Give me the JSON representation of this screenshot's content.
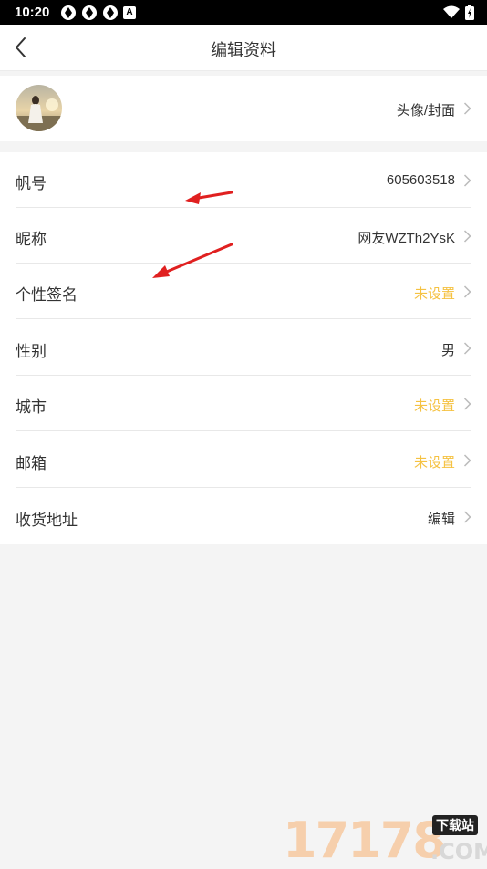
{
  "status_bar": {
    "time": "10:20",
    "notification_badge": "A"
  },
  "nav": {
    "title": "编辑资料",
    "back_icon": "chevron-left-icon"
  },
  "avatar_row": {
    "label": "头像/封面"
  },
  "rows": [
    {
      "label": "帆号",
      "value": "605603518",
      "unset": false
    },
    {
      "label": "昵称",
      "value": "网友WZTh2YsK",
      "unset": false
    },
    {
      "label": "个性签名",
      "value": "未设置",
      "unset": true
    },
    {
      "label": "性别",
      "value": "男",
      "unset": false
    },
    {
      "label": "城市",
      "value": "未设置",
      "unset": true
    },
    {
      "label": "邮箱",
      "value": "未设置",
      "unset": true
    },
    {
      "label": "收货地址",
      "value": "编辑",
      "unset": false
    }
  ],
  "colors": {
    "unset_value": "#f5c242",
    "annotation_arrow": "#e02020",
    "divider": "#e8e8e8",
    "background": "#f4f4f4"
  },
  "watermark": {
    "number": "17178",
    "badge": "下载站",
    "domain": ".COM"
  }
}
